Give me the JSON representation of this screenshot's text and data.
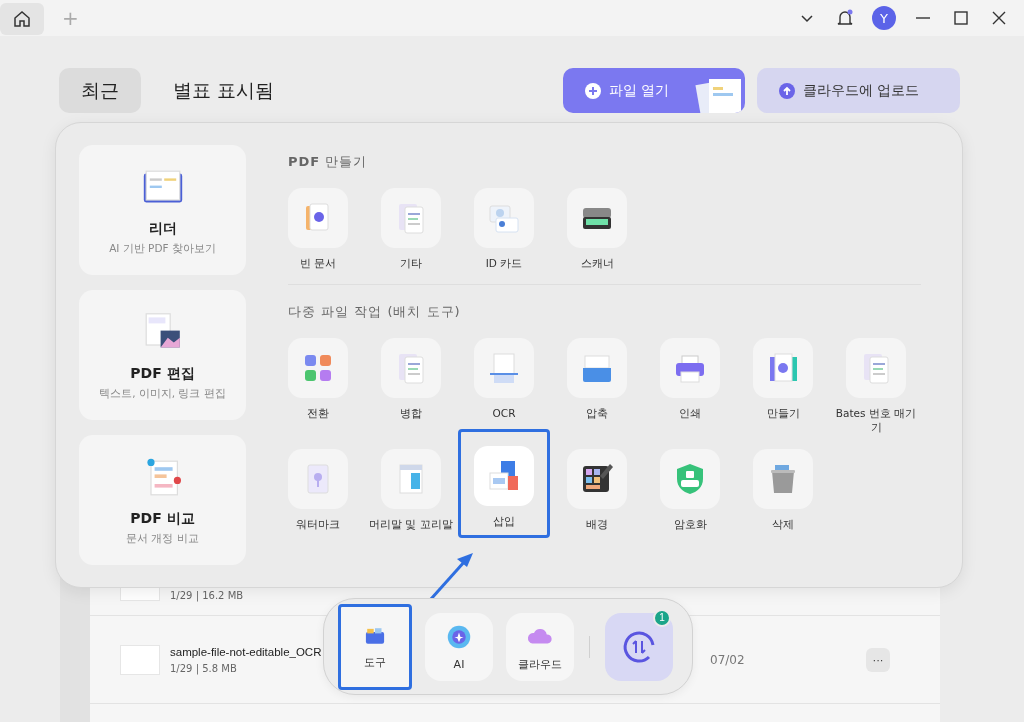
{
  "title_bar": {
    "new_tab": "+",
    "avatar": "Y"
  },
  "tabs": [
    {
      "label": "최근",
      "selected": true
    },
    {
      "label": "별표 표시됨",
      "selected": false
    }
  ],
  "actions": [
    {
      "label": "파일 열기",
      "kind": "primary"
    },
    {
      "label": "클라우드에 업로드",
      "kind": "secondary"
    }
  ],
  "tools_panel": {
    "features": [
      {
        "title": "리더",
        "subtitle": "AI 기반 PDF 찾아보기"
      },
      {
        "title": "PDF 편집",
        "subtitle": "텍스트, 이미지, 링크 편집"
      },
      {
        "title": "PDF 비교",
        "subtitle": "문서 개정 비교"
      }
    ],
    "sections": [
      {
        "title": "**PDF** 만들기",
        "items": [
          {
            "label": "빈 문서",
            "selected": false
          },
          {
            "label": "기타",
            "selected": false
          },
          {
            "label": "ID 카드",
            "selected": false
          },
          {
            "label": "스캐너",
            "selected": false
          }
        ]
      },
      {
        "title": "다중 파일 작업 (배치 도구)",
        "items": [
          {
            "label": "전환",
            "selected": false
          },
          {
            "label": "병합",
            "selected": false
          },
          {
            "label": "OCR",
            "selected": false
          },
          {
            "label": "압축",
            "selected": false
          },
          {
            "label": "인쇄",
            "selected": false
          },
          {
            "label": "만들기",
            "selected": false
          },
          {
            "label": "Bates 번호 매기기",
            "selected": false
          },
          {
            "label": "워터마크",
            "selected": false
          },
          {
            "label": "머리말 및 꼬리말",
            "selected": false
          },
          {
            "label": "삽입",
            "selected": true
          },
          {
            "label": "배경",
            "selected": false
          },
          {
            "label": "암호화",
            "selected": false
          },
          {
            "label": "삭제",
            "selected": false
          }
        ]
      }
    ]
  },
  "files": [
    {
      "meta": "1/29 | 16.2 MB"
    },
    {
      "name": "sample-file-not-editable_OCR",
      "meta": "1/29 | 5.8 MB",
      "date": "07/02",
      "more": "···"
    }
  ],
  "dock": {
    "items": [
      {
        "label": "도구",
        "selected": true
      },
      {
        "label": "AI",
        "selected": false
      },
      {
        "label": "클라우드",
        "selected": false
      }
    ],
    "badge": "1"
  }
}
